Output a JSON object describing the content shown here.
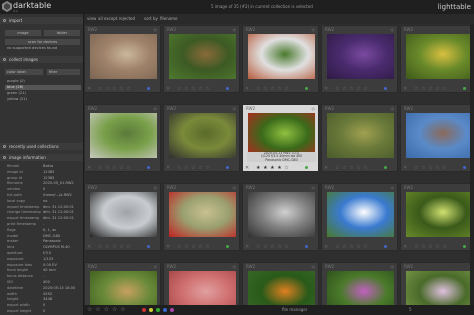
{
  "app": {
    "name": "darktable",
    "version": "3.x",
    "status": "5 image of 35 (#2) in current collection is selected",
    "module": "lighttable"
  },
  "filter": {
    "view_label": "view",
    "view_value": "all except rejected",
    "sort_label": "sort by",
    "sort_value": "filename"
  },
  "left_panel": {
    "import": {
      "title": "import",
      "image_button": "image",
      "folder_button": "folder",
      "scan_button": "scan for devices",
      "no_device_text": "no supported devices found"
    },
    "collect": {
      "title": "collect images",
      "property": "color label",
      "mode": "filter",
      "items": [
        "purple (0)",
        "blue (26)",
        "green (21)",
        "yellow (21)"
      ]
    },
    "recent": {
      "title": "recently used collections"
    },
    "info": {
      "title": "image information",
      "rows": [
        {
          "k": "filmroll",
          "v": "Bakro"
        },
        {
          "k": "image id",
          "v": "12385"
        },
        {
          "k": "group id",
          "v": "12385"
        },
        {
          "k": "filename",
          "v": "2020-05_01.RW2"
        },
        {
          "k": "version",
          "v": "0"
        },
        {
          "k": "full path",
          "v": "/home/.../a.RW2"
        },
        {
          "k": "local copy",
          "v": "no"
        },
        {
          "k": "import timestamp",
          "v": "dim. 31 12:00:01"
        },
        {
          "k": "change timestamp",
          "v": "dim. 31 12:00:01"
        },
        {
          "k": "export timestamp",
          "v": "dim. 31 12:00:01"
        },
        {
          "k": "print timestamp",
          "v": "-"
        },
        {
          "k": "flags",
          "v": "K, 1, ac"
        },
        {
          "k": "model",
          "v": "DMC-G80"
        },
        {
          "k": "maker",
          "v": "Panasonic"
        },
        {
          "k": "lens",
          "v": "OLYMPUS M.40"
        },
        {
          "k": "aperture",
          "v": "f/3.5"
        },
        {
          "k": "exposure",
          "v": "1/125"
        },
        {
          "k": "exposure bias",
          "v": "0.00 EV"
        },
        {
          "k": "focal length",
          "v": "40 mm"
        },
        {
          "k": "focus distance",
          "v": "-"
        },
        {
          "k": "ISO",
          "v": "400"
        },
        {
          "k": "datetime",
          "v": "2020:05:13 18:00"
        },
        {
          "k": "width",
          "v": "4592"
        },
        {
          "k": "height",
          "v": "3448"
        },
        {
          "k": "export width",
          "v": "0"
        },
        {
          "k": "export height",
          "v": "0"
        }
      ]
    }
  },
  "thumbnails": [
    {
      "ext": "RW2",
      "rating": "☆ ☆ ☆ ☆ ☆",
      "label_color": "#4466cc",
      "colors": [
        "#a0826a",
        "#c9b79c",
        "#7a6552"
      ]
    },
    {
      "ext": "RW2",
      "rating": "☆ ☆ ☆ ☆ ☆",
      "label_color": "#4466cc",
      "colors": [
        "#3d5a24",
        "#8a6a3a",
        "#4e7a2e"
      ]
    },
    {
      "ext": "RW2",
      "rating": "☆ ☆ ☆ ☆ ☆",
      "label_color": "#44aa44",
      "colors": [
        "#e0e0e0",
        "#4a7a2e",
        "#b65a3a"
      ]
    },
    {
      "ext": "RW2",
      "rating": "☆ ☆ ☆ ☆ ☆",
      "label_color": "#4466cc",
      "colors": [
        "#4a2b6e",
        "#7a4aa0",
        "#2e1a44"
      ]
    },
    {
      "ext": "RW2",
      "rating": "☆ ☆ ☆ ☆ ☆",
      "label_color": "#44aa44",
      "colors": [
        "#6a8a2a",
        "#d8c040",
        "#3e5a1a"
      ]
    },
    {
      "ext": "RW2",
      "rating": "☆ ☆ ☆ ☆ ☆",
      "label_color": "#4466cc",
      "colors": [
        "#7aa04a",
        "#5a7a3a",
        "#c8c8c0"
      ]
    },
    {
      "ext": "RW2",
      "rating": "☆ ☆ ☆ ☆ ☆",
      "label_color": "#4466cc",
      "colors": [
        "#7a8a3a",
        "#5a6a2a",
        "#2e2e2e"
      ]
    },
    {
      "ext": "RW2",
      "rating": "★ ★ ★ ★ ☆",
      "label_color": "#44aa44",
      "colors": [
        "#3a6a1a",
        "#90c040",
        "#c02020"
      ],
      "highlight": true,
      "tip": [
        "2020-05-13 RW2 (1/1)",
        "1/125 f/3.5 40mm iso 400",
        "Panasonic DMC-G80"
      ]
    },
    {
      "ext": "RW2",
      "rating": "☆ ☆ ☆ ☆ ☆",
      "label_color": "#44aa44",
      "colors": [
        "#6a7a3a",
        "#a0a050",
        "#4a5a2a"
      ]
    },
    {
      "ext": "RW2",
      "rating": "☆ ☆ ☆ ☆ ☆",
      "label_color": "#4466cc",
      "colors": [
        "#5a8ac8",
        "#8a6a5a",
        "#3a6aa8"
      ]
    },
    {
      "ext": "RW2",
      "rating": "☆ ☆ ☆ ☆ ☆",
      "label_color": "#4466cc",
      "colors": [
        "#c8ccd0",
        "#a0a4a8",
        "#222222"
      ]
    },
    {
      "ext": "RW2",
      "rating": "☆ ☆ ☆ ☆ ☆",
      "label_color": "#44aa44",
      "colors": [
        "#9aa070",
        "#c8c090",
        "#c02020"
      ]
    },
    {
      "ext": "RW2",
      "rating": "☆ ☆ ☆ ☆ ☆",
      "label_color": "#4466cc",
      "colors": [
        "#808080",
        "#d0d0d0",
        "#303030"
      ]
    },
    {
      "ext": "RW2",
      "rating": "☆ ☆ ☆ ☆ ☆",
      "label_color": "#4466cc",
      "colors": [
        "#3a7ad0",
        "#ffffff",
        "#4a7a2a"
      ]
    },
    {
      "ext": "RW2",
      "rating": "☆ ☆ ☆ ☆ ☆",
      "label_color": "#44aa44",
      "colors": [
        "#3a5a1a",
        "#d0e070",
        "#6a8a2a"
      ]
    },
    {
      "ext": "RW2",
      "rating": "",
      "label_color": "#4466cc",
      "colors": [
        "#6a8a3a",
        "#c8a060",
        "#3a5a1a"
      ]
    },
    {
      "ext": "RW2",
      "rating": "",
      "label_color": "#4466cc",
      "colors": [
        "#d07070",
        "#e0a0a0",
        "#a04040"
      ]
    },
    {
      "ext": "RW2",
      "rating": "",
      "label_color": "#44aa44",
      "colors": [
        "#2a5a1a",
        "#e08020",
        "#3a6a2a"
      ]
    },
    {
      "ext": "RW2",
      "rating": "",
      "label_color": "#44aa44",
      "colors": [
        "#4a7a2a",
        "#c060c0",
        "#2a4a1a"
      ]
    },
    {
      "ext": "RW2",
      "rating": "",
      "label_color": "#4466cc",
      "colors": [
        "#4a6a2a",
        "#e0c0e0",
        "#7a9a4a"
      ]
    }
  ],
  "bottom": {
    "rating": "☆ ☆ ☆ ☆ ☆",
    "color_labels": [
      "#cc3333",
      "#cccc33",
      "#33aa33",
      "#3366cc",
      "#aa44aa"
    ],
    "layout": "file manager",
    "zoom": "5"
  }
}
